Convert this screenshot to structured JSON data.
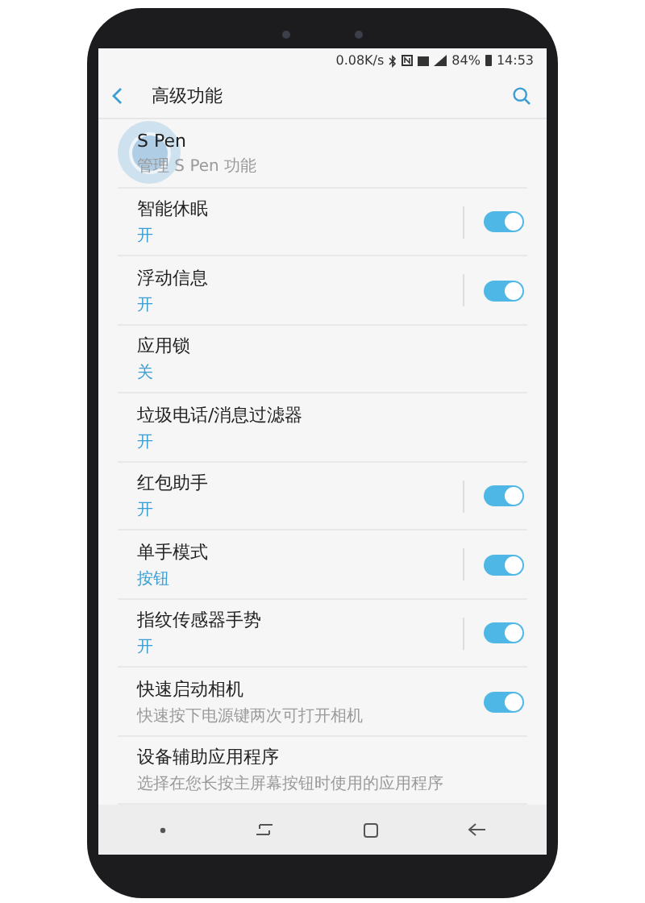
{
  "status_bar": {
    "net_speed": "0.08K/s",
    "battery": "84%",
    "time": "14:53"
  },
  "header": {
    "title": "高级功能"
  },
  "rows": [
    {
      "title": "S Pen",
      "subtitle": "管理 S Pen 功能",
      "accent": false,
      "kind": "plain",
      "touched": true
    },
    {
      "title": "智能休眠",
      "subtitle": "开",
      "accent": true,
      "kind": "toggle",
      "on": true,
      "split": true,
      "touched": false
    },
    {
      "title": "浮动信息",
      "subtitle": "开",
      "accent": true,
      "kind": "toggle",
      "on": true,
      "split": true,
      "touched": false
    },
    {
      "title": "应用锁",
      "subtitle": "关",
      "accent": true,
      "kind": "plain",
      "touched": false
    },
    {
      "title": "垃圾电话/消息过滤器",
      "subtitle": "开",
      "accent": true,
      "kind": "plain",
      "touched": false
    },
    {
      "title": "红包助手",
      "subtitle": "开",
      "accent": true,
      "kind": "toggle",
      "on": true,
      "split": true,
      "touched": false
    },
    {
      "title": "单手模式",
      "subtitle": "按钮",
      "accent": true,
      "kind": "toggle",
      "on": true,
      "split": true,
      "touched": false
    },
    {
      "title": "指纹传感器手势",
      "subtitle": "开",
      "accent": true,
      "kind": "toggle",
      "on": true,
      "split": true,
      "touched": false
    },
    {
      "title": "快速启动相机",
      "subtitle": "快速按下电源键两次可打开相机",
      "accent": false,
      "kind": "toggle",
      "on": true,
      "split": false,
      "touched": false
    },
    {
      "title": "设备辅助应用程序",
      "subtitle": "选择在您长按主屏幕按钮时使用的应用程序",
      "accent": false,
      "kind": "plain",
      "touched": false
    }
  ]
}
